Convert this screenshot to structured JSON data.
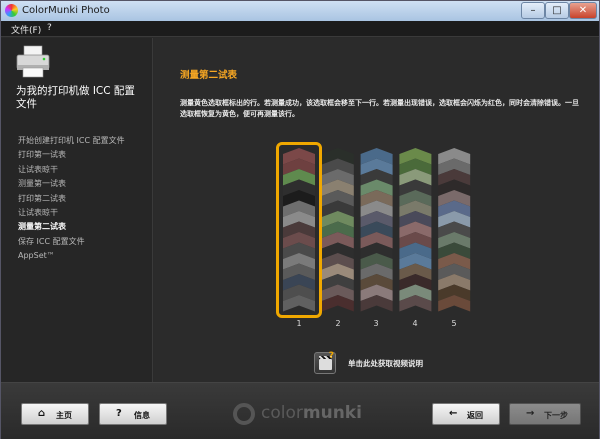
{
  "window": {
    "title": "ColorMunki Photo",
    "minimize_glyph": "–",
    "maximize_glyph": "□",
    "close_glyph": "✕"
  },
  "menu": {
    "file": "文件(F)",
    "help": "?"
  },
  "sidebar": {
    "title": "为我的打印机做 ICC 配置文件",
    "steps": [
      {
        "label": "开始创建打印机 ICC 配置文件",
        "active": false
      },
      {
        "label": "打印第一试表",
        "active": false
      },
      {
        "label": "让试表晾干",
        "active": false
      },
      {
        "label": "测量第一试表",
        "active": false
      },
      {
        "label": "打印第二试表",
        "active": false
      },
      {
        "label": "让试表晾干",
        "active": false
      },
      {
        "label": "测量第二试表",
        "active": true
      },
      {
        "label": "保存 ICC 配置文件",
        "active": false
      },
      {
        "label": "AppSet™",
        "active": false
      }
    ]
  },
  "main": {
    "title": "测量第二试表",
    "instructions": "测量黄色选取框标出的行。若测量成功，该选取框会移至下一行。若测量出现错误，选取框会闪烁为红色，同时会清除错误。一旦选取框恢复为黄色，便可再测量该行。",
    "selected_strip": 1,
    "strip_numbers": [
      "1",
      "2",
      "3",
      "4",
      "5"
    ],
    "video_help": "单击此处获取视频说明"
  },
  "colors": {
    "accent": "#f5a623",
    "selector": "#f0a800",
    "strips": [
      [
        "#7b4848",
        "#6e4040",
        "#5f8a4e",
        "#2e2e2e",
        "#1c1c1c",
        "#6e6e6e",
        "#8a8a8a",
        "#4a3a3a",
        "#6b4c4c",
        "#4a4a4a",
        "#7a7a7a",
        "#5a5a5a",
        "#3a4555",
        "#4e4e4e",
        "#606060"
      ],
      [
        "#2a2f2a",
        "#4a4a4a",
        "#6b6b6b",
        "#8a8070",
        "#5a5a5a",
        "#3a3a3a",
        "#6f8a5f",
        "#4b6b4b",
        "#7b5a5a",
        "#2e2e2e",
        "#5c4e4e",
        "#9a8a7a",
        "#3f3f3f",
        "#6a5a5a",
        "#4a2e2e"
      ],
      [
        "#4a6a8a",
        "#5a7a9a",
        "#3a3a3a",
        "#6a8a6a",
        "#7a6a5a",
        "#8a8a8a",
        "#5a5a6a",
        "#3a4a5a",
        "#7a5a5a",
        "#2e2e2e",
        "#4a5a4a",
        "#6a6a6a",
        "#5a4a3a",
        "#8a7a7a",
        "#4a3a3a"
      ],
      [
        "#6a8a4a",
        "#4a6a3a",
        "#8a9a7a",
        "#3a3a3a",
        "#5a6a5a",
        "#7a7a6a",
        "#4a4a5a",
        "#8a6a6a",
        "#6a4a4a",
        "#4a6a8a",
        "#5a7a9a",
        "#6a5a4a",
        "#3a2a2a",
        "#7a8a7a",
        "#5a4a4a"
      ],
      [
        "#8a8a8a",
        "#6a6a6a",
        "#4a3a3a",
        "#2e2a2a",
        "#7a6a6a",
        "#5a6a8a",
        "#8a9aaa",
        "#4a4a4a",
        "#6a7a6a",
        "#3a4a3a",
        "#7a5a4a",
        "#5a5a5a",
        "#8a7a6a",
        "#4a3a2a",
        "#6a4a3a"
      ]
    ]
  },
  "icons": {
    "printer": "printer-icon",
    "home": "home-icon",
    "info": "help-icon",
    "back": "arrow-left-icon",
    "next": "arrow-right-icon",
    "video": "video-clapper-icon"
  },
  "footer": {
    "home_label": "主页",
    "home_glyph": "⌂",
    "info_label": "信息",
    "info_glyph": "?",
    "back_label": "返回",
    "back_glyph": "←",
    "next_label": "下一步",
    "next_glyph": "→",
    "logo_text_1": "color",
    "logo_text_2": "munki"
  }
}
